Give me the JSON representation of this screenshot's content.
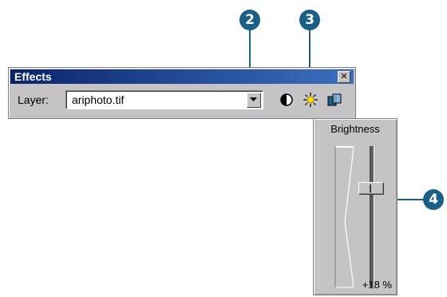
{
  "window": {
    "title": "Effects",
    "close_glyph": "✕"
  },
  "layer": {
    "label": "Layer:",
    "value": "ariphoto.tif"
  },
  "toolbar_icons": [
    "contrast-icon",
    "brightness-icon",
    "transparency-icon"
  ],
  "brightness_panel": {
    "title": "Brightness",
    "value_text": "+18 %",
    "level_percent": 18
  },
  "callouts": [
    {
      "number": "2",
      "target": "layer-dropdown-button"
    },
    {
      "number": "3",
      "target": "brightness-icon"
    },
    {
      "number": "4",
      "target": "brightness-slider"
    }
  ],
  "colors": {
    "callout": "#1a5f86",
    "titlebar_start": "#0a246a",
    "titlebar_end": "#3b6fc0",
    "sun": "#ffdd00"
  }
}
